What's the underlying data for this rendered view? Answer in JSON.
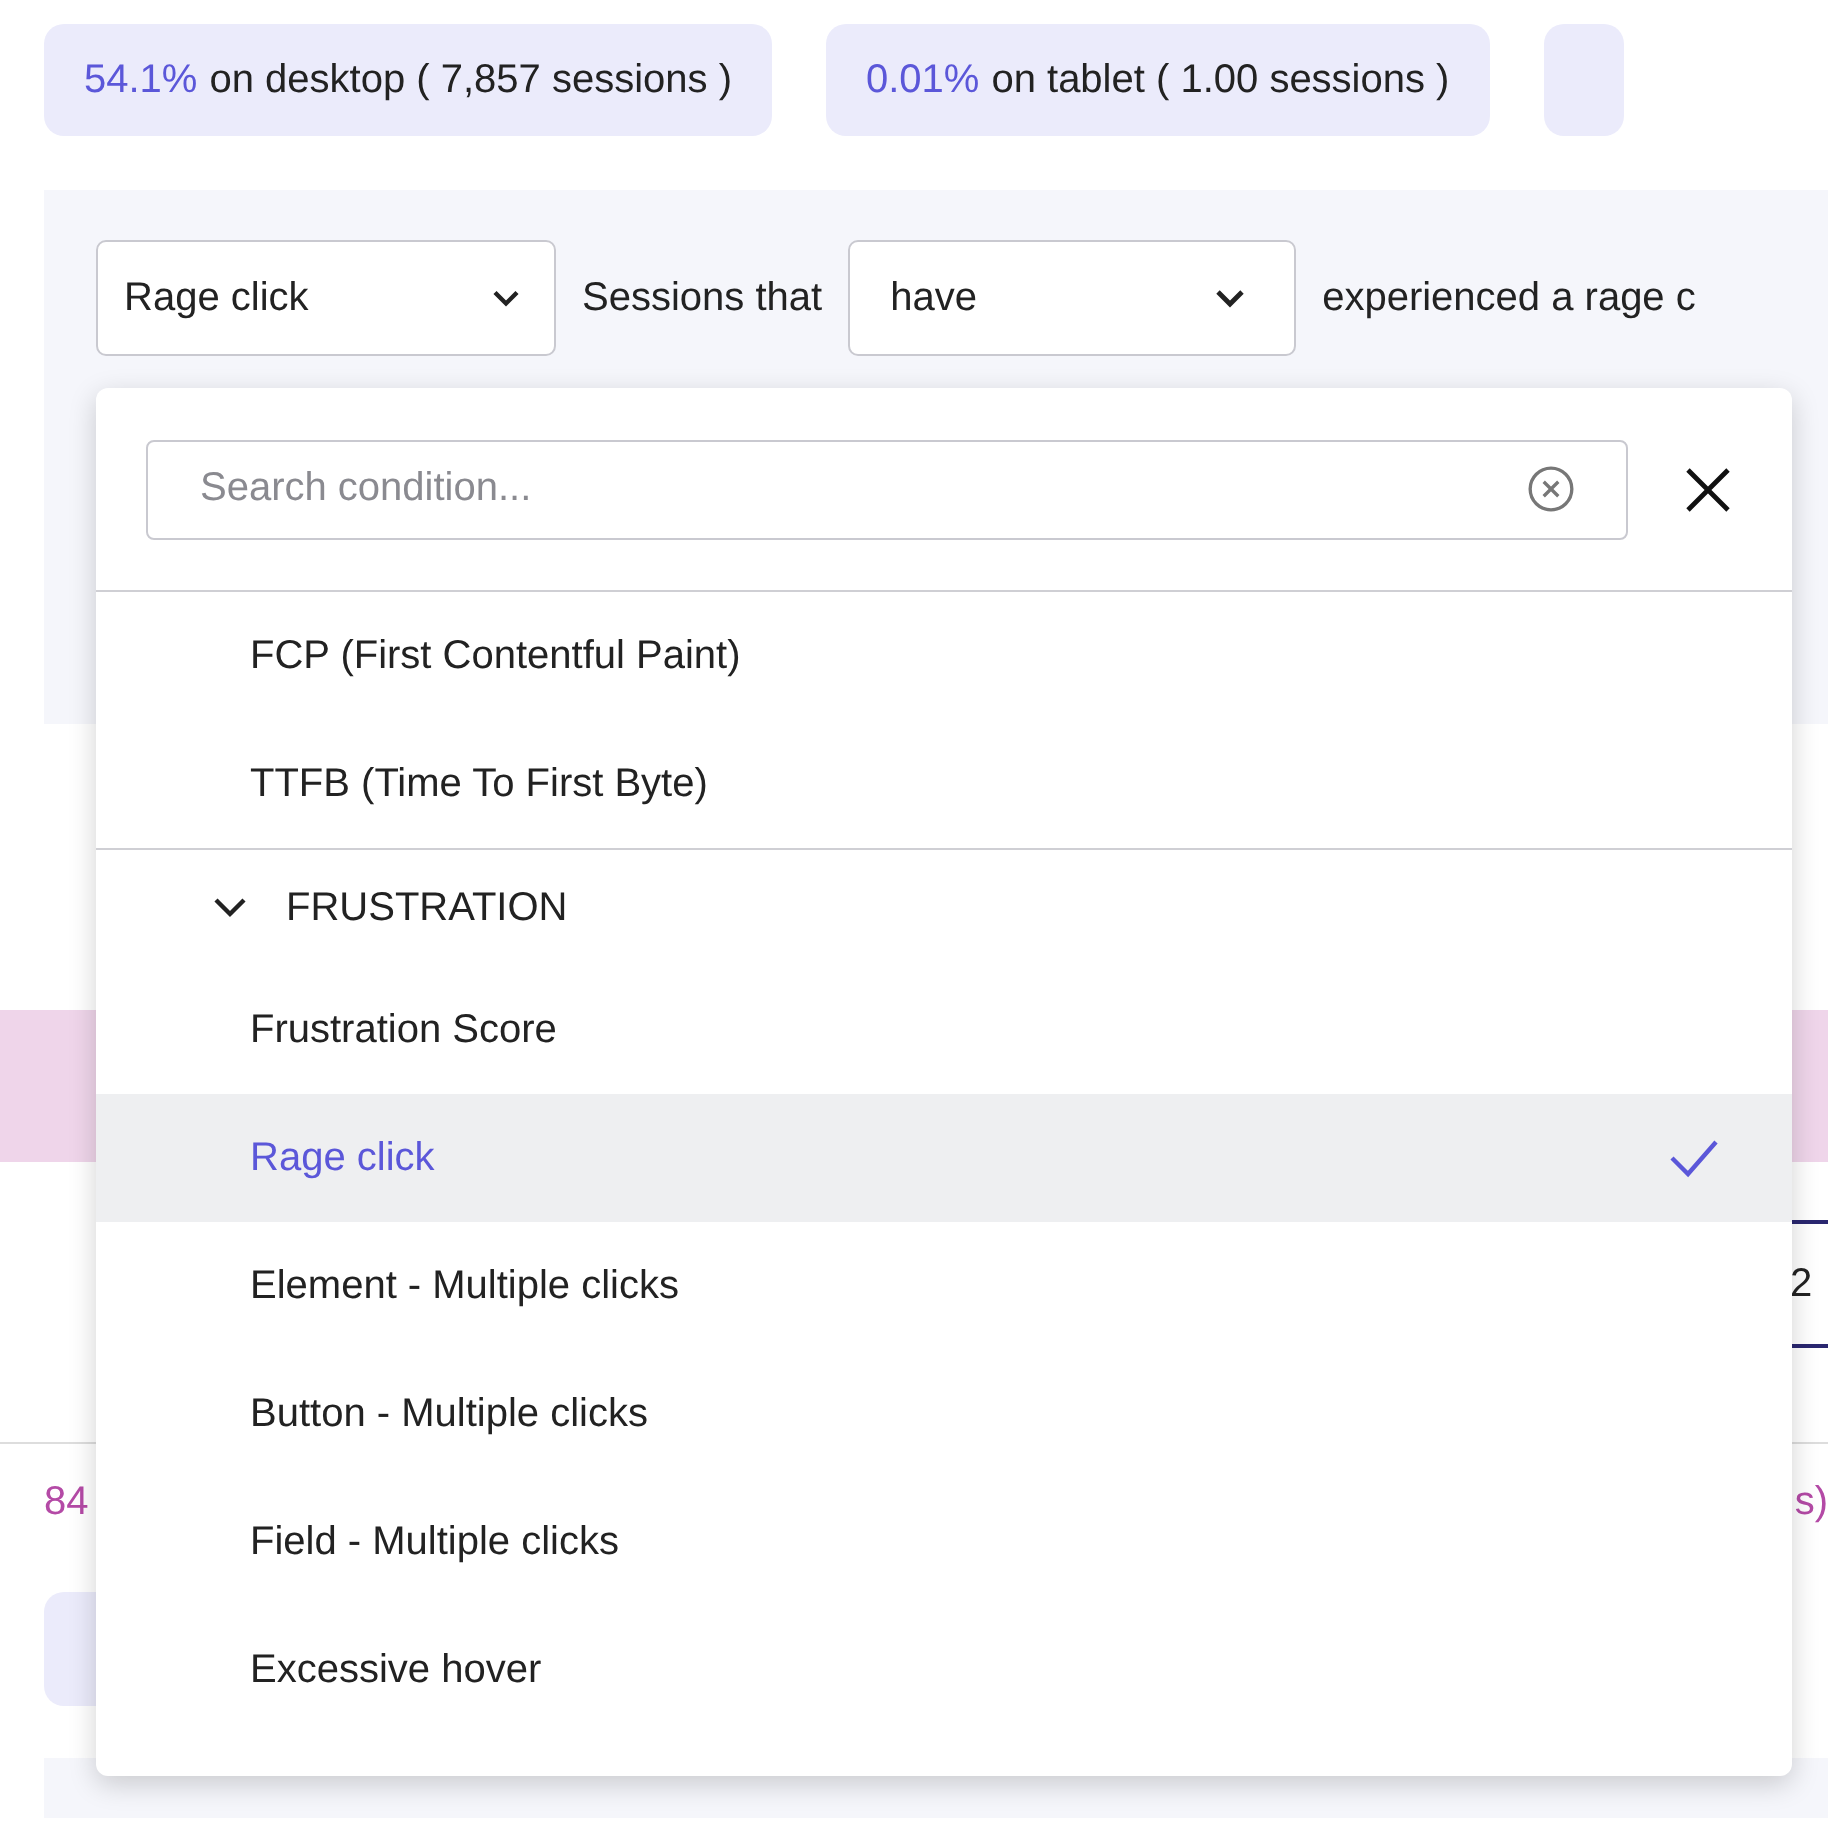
{
  "device_chips": [
    {
      "percent": "54.1%",
      "text": "on desktop ( 7,857 sessions )"
    },
    {
      "percent": "0.01%",
      "text": "on tablet ( 1.00 sessions )"
    }
  ],
  "filter": {
    "condition_select": "Rage click",
    "label": "Sessions that",
    "operator_select": "have",
    "description": "experienced a rage c"
  },
  "background_fragments": {
    "tab_value": "2",
    "left_stat": "84",
    "right_stat": "s)"
  },
  "dropdown": {
    "search": {
      "placeholder": "Search condition..."
    },
    "items_before": [
      {
        "label": "FCP (First Contentful Paint)",
        "selected": false
      },
      {
        "label": "TTFB (Time To First Byte)",
        "selected": false
      }
    ],
    "group": {
      "label": "FRUSTRATION",
      "expanded": true,
      "items": [
        {
          "label": "Frustration Score",
          "selected": false
        },
        {
          "label": "Rage click",
          "selected": true
        },
        {
          "label": "Element - Multiple clicks",
          "selected": false
        },
        {
          "label": "Button - Multiple clicks",
          "selected": false
        },
        {
          "label": "Field - Multiple clicks",
          "selected": false
        },
        {
          "label": "Excessive hover",
          "selected": false
        }
      ]
    }
  }
}
